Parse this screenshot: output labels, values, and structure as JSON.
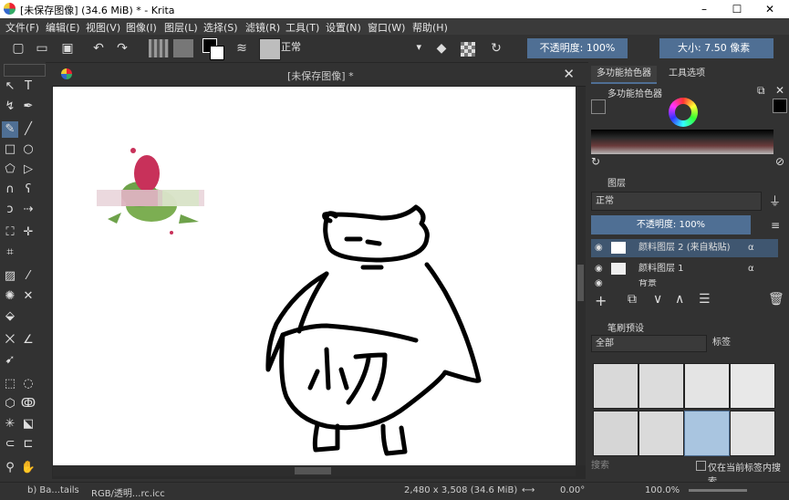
{
  "window": {
    "title": "[未保存图像] (34.6 MiB) * - Krita",
    "controls": [
      "–",
      "☐",
      "✕"
    ]
  },
  "menu": [
    "文件(F)",
    "编辑(E)",
    "视图(V)",
    "图像(I)",
    "图层(L)",
    "选择(S)",
    "滤镜(R)",
    "工具(T)",
    "设置(N)",
    "窗口(W)",
    "帮助(H)"
  ],
  "toolbar": {
    "blend_mode": "正常",
    "opacity": "不透明度: 100%",
    "size": "大小: 7.50 像素"
  },
  "document": {
    "tab_title": "[未保存图像] *",
    "drawing_text": "小刀"
  },
  "dock": {
    "tabs": [
      "多功能拾色器",
      "工具选项"
    ],
    "color_panel_title": "多功能拾色器",
    "layers_title": "图层",
    "layer_blend": "正常",
    "layer_opacity": "不透明度: 100%",
    "layers": [
      {
        "name": "颜料图层 2 (来自粘贴)",
        "selected": true
      },
      {
        "name": "颜料图层 1",
        "selected": false
      },
      {
        "name": "背景",
        "selected": false
      }
    ],
    "brush_title": "笔刷预设",
    "brush_filter": "全部",
    "brush_tag_label": "标签",
    "search_placeholder": "搜索",
    "only_current_tag": "仅在当前标签内搜索"
  },
  "status": {
    "brush": "b) Ba...tails",
    "colorspace": "RGB/透明...rc.icc",
    "dimensions": "2,480 x 3,508 (34.6 MiB)",
    "rotation": "0.00°",
    "zoom": "100.0%"
  },
  "colors": {
    "accent": "#4f6f94",
    "bg": "#323232",
    "selected_row": "#3f5670"
  }
}
